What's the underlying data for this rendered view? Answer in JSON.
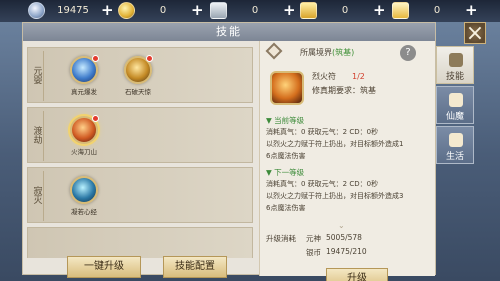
{
  "resources": [
    {
      "name": "pearl",
      "icon": "pearl-icon",
      "value": "19475"
    },
    {
      "name": "coin",
      "icon": "coin-icon",
      "value": "0"
    },
    {
      "name": "silver_ingot",
      "icon": "silver-ingot-icon",
      "value": "0"
    },
    {
      "name": "gold_ingot",
      "icon": "gold-ingot-icon",
      "value": "0"
    },
    {
      "name": "gold_ingot_2",
      "icon": "gold-ingot-icon",
      "value": "0"
    }
  ],
  "panel": {
    "title": "技能"
  },
  "left": {
    "rows": [
      {
        "label": "元婴",
        "skills": [
          {
            "name": "真元爆发",
            "icon": "blue-rune-icon",
            "dot": true
          },
          {
            "name": "石破天惊",
            "icon": "gold-rune-icon",
            "dot": true
          }
        ]
      },
      {
        "label": "渡劫",
        "skills": [
          {
            "name": "火海刀山",
            "icon": "fire-figure-icon",
            "dot": true,
            "selected": true
          }
        ]
      },
      {
        "label": "寂灭",
        "skills": [
          {
            "name": "凝若心经",
            "icon": "ice-rune-icon",
            "dot": false
          }
        ]
      }
    ],
    "buttons": {
      "one_click": "一键升级",
      "config": "技能配置"
    }
  },
  "right": {
    "realm_label": "所属境界",
    "realm_value": "(筑基)",
    "skill_name": "烈火符",
    "skill_level": "1/2",
    "requirement": "修真期要求：筑基",
    "current_level_title": "当前等级",
    "current": {
      "cost_line": "消耗真气：0  获取元气：2  CD：0秒",
      "desc_line1": "以烈火之力赋于符上扔出，对目标额外造成1",
      "desc_line2": "6点魔法伤害"
    },
    "next_level_title": "下一等级",
    "next": {
      "cost_line": "消耗真气：0  获取元气：2  CD：0秒",
      "desc_line1": "以烈火之力赋于符上扔出，对目标额外造成3",
      "desc_line2": "6点魔法伤害"
    },
    "upgrade_cost_label": "升级消耗",
    "costs": [
      {
        "k": "元神",
        "v": "5005/578"
      },
      {
        "k": "银币",
        "v": "19475/210"
      }
    ],
    "upgrade_button": "升级"
  },
  "tabs": [
    {
      "label": "技能",
      "icon": "skill-book-icon",
      "active": true
    },
    {
      "label": "仙魔",
      "icon": "immortal-demon-icon",
      "active": false
    },
    {
      "label": "生活",
      "icon": "life-icon",
      "active": false
    }
  ],
  "colors": {
    "accent_green": "#3e8f36",
    "accent_red": "#d2412f",
    "button_gold": "#d9bd7d"
  }
}
